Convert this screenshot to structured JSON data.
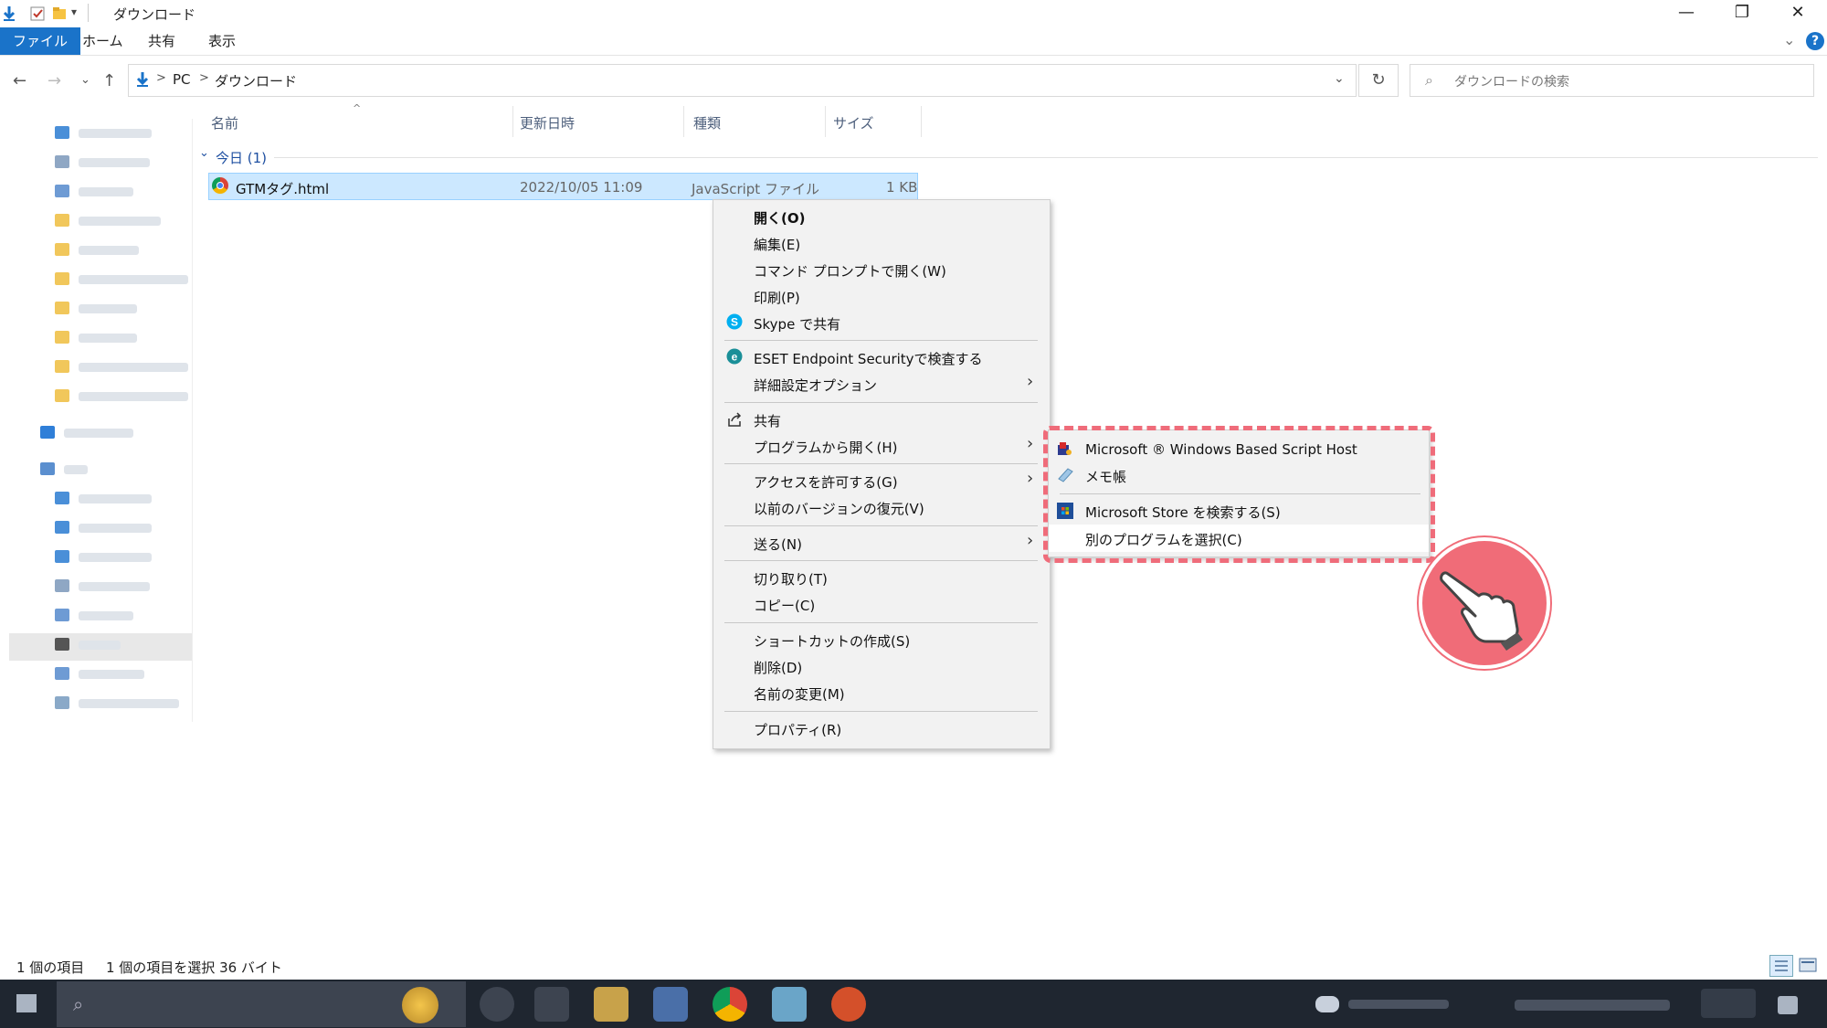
{
  "window": {
    "title": "ダウンロード",
    "minimize_glyph": "—",
    "restore_glyph": "❐",
    "close_glyph": "✕"
  },
  "ribbon": {
    "tabs": [
      "ファイル",
      "ホーム",
      "共有",
      "表示"
    ],
    "help_glyph": "?"
  },
  "address": {
    "crumbs": [
      "PC",
      "ダウンロード"
    ],
    "search_placeholder": "ダウンロードの検索"
  },
  "columns": {
    "name": "名前",
    "modified": "更新日時",
    "type": "種類",
    "size": "サイズ"
  },
  "group": {
    "label": "今日 (1)"
  },
  "file": {
    "name": "GTMタグ.html",
    "modified": "2022/10/05 11:09",
    "type": "JavaScript ファイル",
    "size": "1 KB"
  },
  "context_menu": {
    "items": [
      "開く(O)",
      "編集(E)",
      "コマンド プロンプトで開く(W)",
      "印刷(P)",
      "Skype で共有",
      "ESET Endpoint Securityで検査する",
      "詳細設定オプション",
      "共有",
      "プログラムから開く(H)",
      "アクセスを許可する(G)",
      "以前のバージョンの復元(V)",
      "送る(N)",
      "切り取り(T)",
      "コピー(C)",
      "ショートカットの作成(S)",
      "削除(D)",
      "名前の変更(M)",
      "プロパティ(R)"
    ]
  },
  "open_with_submenu": {
    "items": [
      "Microsoft ® Windows Based Script Host",
      "メモ帳",
      "Microsoft Store を検索する(S)",
      "別のプログラムを選択(C)"
    ]
  },
  "status": {
    "count": "1 個の項目",
    "selected": "1 個の項目を選択  36 バイト"
  },
  "colors": {
    "accent": "#1a73c9",
    "selection": "#cce8ff",
    "highlight_dash": "#ef6c7a",
    "taskbar": "#1f2630"
  }
}
